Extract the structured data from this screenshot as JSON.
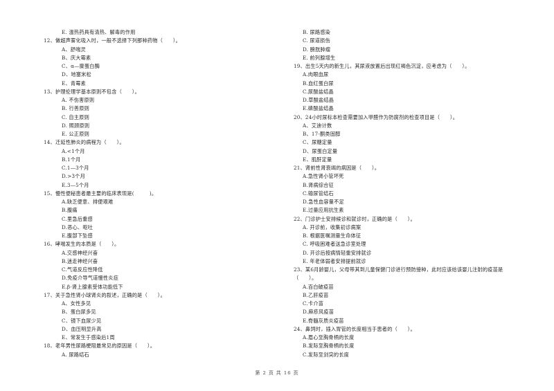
{
  "left_column": [
    {
      "type": "opt",
      "text": "E. 温热药具有清热、解毒的作用"
    },
    {
      "type": "q",
      "text": "12、做超声雾化吸入时，一般不选择下列那种药物（　　）。"
    },
    {
      "type": "opt",
      "text": "A、舒喘灵"
    },
    {
      "type": "opt",
      "text": "B、庆大霉素"
    },
    {
      "type": "opt",
      "text": "C、α—糜蛋白酶"
    },
    {
      "type": "opt",
      "text": "D、地塞米松"
    },
    {
      "type": "opt",
      "text": "E、青霉素"
    },
    {
      "type": "q",
      "text": "13、护理伦理学基本原则不包含（　　）。"
    },
    {
      "type": "opt",
      "text": "A. 不伤害原则"
    },
    {
      "type": "opt",
      "text": "B. 行善原则"
    },
    {
      "type": "opt",
      "text": "C. 自主原则"
    },
    {
      "type": "opt",
      "text": "D. 照顾原则"
    },
    {
      "type": "opt",
      "text": "E. 公正原则"
    },
    {
      "type": "q",
      "text": "14、迁延性肺炎的病程为（　　）。"
    },
    {
      "type": "opt",
      "text": "A.<1个月"
    },
    {
      "type": "opt",
      "text": "B.1个月"
    },
    {
      "type": "opt",
      "text": "C.1—3个月"
    },
    {
      "type": "opt",
      "text": "D.>3个月"
    },
    {
      "type": "opt",
      "text": "E.3—5个月"
    },
    {
      "type": "q",
      "text": "15、慢性便秘患者最主要的临床表现是(　　　)。"
    },
    {
      "type": "opt",
      "text": "A.缺乏便意、排便艰难"
    },
    {
      "type": "opt",
      "text": "B.腹痛"
    },
    {
      "type": "opt",
      "text": "C.里急后重感"
    },
    {
      "type": "opt",
      "text": "D.恶心、呕吐"
    },
    {
      "type": "opt",
      "text": "E.腹部下坠感"
    },
    {
      "type": "q",
      "text": "16、哮喘发生的本质是（　　）。"
    },
    {
      "type": "opt",
      "text": "A.交感神经兴奋"
    },
    {
      "type": "opt",
      "text": "B.迷走神经兴奋"
    },
    {
      "type": "opt",
      "text": "C.气道反应性降低"
    },
    {
      "type": "opt",
      "text": "D.免疫介导气道慢性炎症"
    },
    {
      "type": "opt",
      "text": "E.β-肾上腺素受体功能低下"
    },
    {
      "type": "q",
      "text": "17、关于急性肾小球肾炎的叙述，正确的是（　　）。"
    },
    {
      "type": "opt",
      "text": "A、女性多见"
    },
    {
      "type": "opt",
      "text": "B、蛋白尿多见"
    },
    {
      "type": "opt",
      "text": "C、镜下血尿少见"
    },
    {
      "type": "opt",
      "text": "D、血压明显升高"
    },
    {
      "type": "opt",
      "text": "E、常发生于感染后1周"
    },
    {
      "type": "q",
      "text": "18、老年男性尿路梗阻最常见的原因是（　　）。"
    },
    {
      "type": "opt",
      "text": "A. 尿路结石"
    }
  ],
  "right_column": [
    {
      "type": "opt",
      "text": "B. 尿路感染"
    },
    {
      "type": "opt",
      "text": "C. 尿道损伤"
    },
    {
      "type": "opt",
      "text": "D. 膀胱肿瘤"
    },
    {
      "type": "opt",
      "text": "E. 前列腺增生"
    },
    {
      "type": "q",
      "text": "19、出生5天内的新生儿，其尿液放置后出现红褐色沉淀，应考虑为（　　）。"
    },
    {
      "type": "opt",
      "text": "A.肉眼血尿"
    },
    {
      "type": "opt",
      "text": "B.血红蛋白尿"
    },
    {
      "type": "opt",
      "text": "C.尿酸盐结晶"
    },
    {
      "type": "opt",
      "text": "D.草酸盐结晶"
    },
    {
      "type": "opt",
      "text": "E.磷酸盐结晶"
    },
    {
      "type": "q",
      "text": "20、24小时尿标本检查需要加入甲醛作为防腐剂的检查项目是（　　）。"
    },
    {
      "type": "opt",
      "text": "A、艾迪计数"
    },
    {
      "type": "opt",
      "text": "B、17-酮类固醇"
    },
    {
      "type": "opt",
      "text": "C、尿糖定量"
    },
    {
      "type": "opt",
      "text": "D、尿蛋白定量"
    },
    {
      "type": "opt",
      "text": "E、肌酐定量"
    },
    {
      "type": "q",
      "text": "21、肾前性肾衰竭的病因是（　　）。"
    },
    {
      "type": "opt",
      "text": "A.急性肾小管坏死"
    },
    {
      "type": "opt",
      "text": "B.肾病综合征"
    },
    {
      "type": "opt",
      "text": "C.输尿管结石"
    },
    {
      "type": "opt",
      "text": "D.急性血容量不足"
    },
    {
      "type": "opt",
      "text": "E.过量应用抗生素"
    },
    {
      "type": "q",
      "text": "22、门诊护士安排候诊和就诊时，正确的是（　　）。"
    },
    {
      "type": "opt",
      "text": "A. 开诊前，收集初诊病案"
    },
    {
      "type": "opt",
      "text": "B. 根据医嘱测量生命体征"
    },
    {
      "type": "opt",
      "text": "C. 呼吸困难者送急诊室处理"
    },
    {
      "type": "opt",
      "text": "D. 开诊后按病情轻重安排就诊"
    },
    {
      "type": "opt",
      "text": "E. 年老体弱者安排提前就诊"
    },
    {
      "type": "q",
      "text": "23、某6月龄婴儿，父母带其到儿童保健门诊进行预防接种，此时应该给该婴儿注射的疫苗是"
    },
    {
      "type": "q",
      "text": "（　　）。"
    },
    {
      "type": "opt",
      "text": "A.百白破疫苗"
    },
    {
      "type": "opt",
      "text": "B.乙肝疫苗"
    },
    {
      "type": "opt",
      "text": "C.卡介苗"
    },
    {
      "type": "opt",
      "text": "D.麻疹风疫苗"
    },
    {
      "type": "opt",
      "text": "E.脊髓灰质炎疫苗"
    },
    {
      "type": "q",
      "text": "24、鼻饲时，插入胃管的长度相当于患者的（　　）。"
    },
    {
      "type": "opt",
      "text": "A.眉心至胸骨柄的长度"
    },
    {
      "type": "opt",
      "text": "B.发际至胸骨柄的长度"
    },
    {
      "type": "opt",
      "text": "C.发际至剑突的长度"
    }
  ],
  "footer": {
    "page_label": "第 2 页 共 16 页"
  }
}
